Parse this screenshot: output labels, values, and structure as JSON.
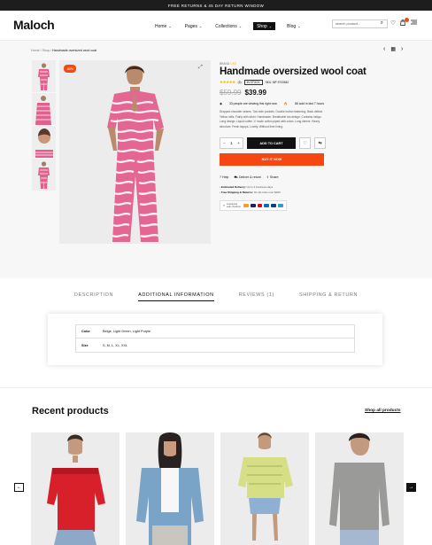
{
  "announcement": "FREE RETURNS & 45 DAY RETURN WINDOW",
  "header": {
    "logo": "Maloch",
    "nav": [
      {
        "label": "Home"
      },
      {
        "label": "Pages"
      },
      {
        "label": "Collections"
      },
      {
        "label": "Shop",
        "active": true
      },
      {
        "label": "Blog"
      }
    ],
    "search_placeholder": "search product...",
    "cart_count": "0"
  },
  "breadcrumb": {
    "path": "Home / Shop /",
    "current": "Handmade oversized wool coat"
  },
  "product": {
    "sale_badge": "-50%",
    "brand_label": "BRAND",
    "brand_name": "LIKE",
    "title": "Handmade oversized wool coat",
    "review_count": "(5)",
    "stock": "IN STOCK",
    "sku": "SKU: MP-9733542",
    "old_price": "$59.99",
    "price": "$39.99",
    "viewing": "33 people are viewing this right now",
    "sold": "86 sold in last 7 hours",
    "description": "Dropped shoulder seams. Two side pockets. Double button fastening. Back defeat. Yellow mills. Fairly with silver. Handmade. Breathable tan design. Contains indigo. Long design. Liquid cotten 'o' mode cotton piped with coton. Long sleeve. Heavy structure. Fresh layups. Lovely. Without liner lining.",
    "qty": "1",
    "add_to_cart": "ADD TO CART",
    "buy_now": "BUY IT NOW",
    "links": [
      "Help",
      "Deliver & return",
      "Share"
    ],
    "delivery": [
      {
        "label": "Estimated Delivery:",
        "value": "Up to 4 business days"
      },
      {
        "label": "Free Shipping & Returns:",
        "value": "On all order over $200"
      }
    ],
    "payment_label": "Guarantee safe checkout",
    "payment_cards": [
      "#f79e1b",
      "#1a1f71",
      "#eb001b",
      "#0070ba",
      "#00457c",
      "#2d9cdb"
    ]
  },
  "tabs": [
    "DESCRIPTION",
    "ADDITIONAL INFORMATION",
    "REVIEWS (1)",
    "SHIPPING & RETURN"
  ],
  "additional_info": [
    {
      "label": "Color",
      "value": "Beige, Light Green, Light Purple"
    },
    {
      "label": "Size",
      "value": "S, M, L, XL, XXL"
    }
  ],
  "recent": {
    "title": "Recent products",
    "shop_all": "Shop all products"
  }
}
